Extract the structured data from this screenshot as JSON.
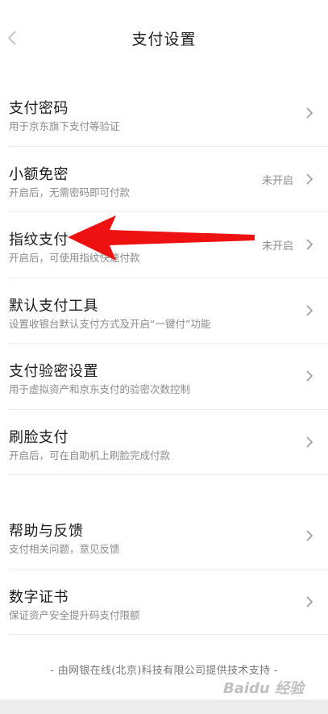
{
  "header": {
    "title": "支付设置",
    "back_icon": "chevron-left-icon"
  },
  "settings": [
    {
      "title": "支付密码",
      "subtitle": "用于京东旗下支付等验证",
      "status": ""
    },
    {
      "title": "小额免密",
      "subtitle": "开启后，无需密码即可付款",
      "status": "未开启"
    },
    {
      "title": "指纹支付",
      "subtitle": "开启后，可使用指纹快速付款",
      "status": "未开启"
    },
    {
      "title": "默认支付工具",
      "subtitle": "设置收银台默认支付方式及开启“一键付”功能",
      "status": ""
    },
    {
      "title": "支付验密设置",
      "subtitle": "用于虚拟资产和京东支付的验密次数控制",
      "status": ""
    },
    {
      "title": "刷脸支付",
      "subtitle": "开启后，可在自助机上刷脸完成付款",
      "status": ""
    }
  ],
  "settings2": [
    {
      "title": "帮助与反馈",
      "subtitle": "支付相关问题，意见反馈",
      "status": ""
    },
    {
      "title": "数字证书",
      "subtitle": "保证资产安全提升码支付限额",
      "status": ""
    }
  ],
  "footer": "- 由网银在线(北京)科技有限公司提供技术支持 -",
  "watermark": "Baidu 经验",
  "colors": {
    "arrow": "#ee1111",
    "divider": "#ececec",
    "subtitle": "#8a8a8a"
  }
}
